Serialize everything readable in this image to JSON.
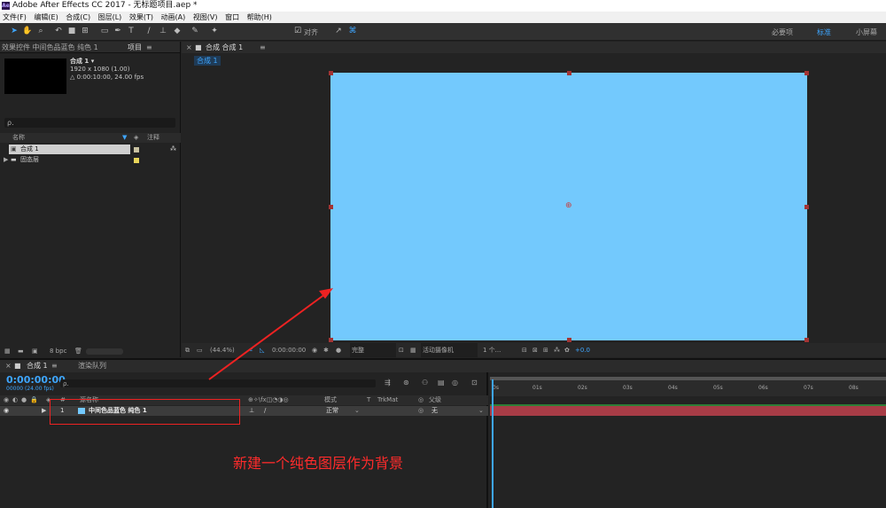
{
  "window": {
    "title": "Adobe After Effects CC 2017 - 无标题项目.aep *",
    "logo": "Ae"
  },
  "menu": [
    "文件(F)",
    "编辑(E)",
    "合成(C)",
    "图层(L)",
    "效果(T)",
    "动画(A)",
    "视图(V)",
    "窗口",
    "帮助(H)"
  ],
  "toolbar": {
    "align_label": "对齐",
    "workspaces": [
      "必要项",
      "标准",
      "小屏幕"
    ],
    "active_workspace": "标准"
  },
  "project": {
    "header": "效果控件 中间色品蓝色 纯色 1",
    "tab": "项目",
    "comp_name": "合成 1 ▾",
    "comp_size": "1920 x 1080 (1.00)",
    "comp_duration": "△ 0:00:10:00, 24.00 fps",
    "search_placeholder": "ρ.",
    "col_name": "名称",
    "col_note": "注释",
    "items": [
      {
        "name": "合成 1",
        "color": "#c9c2a2"
      },
      {
        "name": "固态层",
        "color": "#e8d55a"
      }
    ],
    "bpc": "8 bpc"
  },
  "viewer": {
    "tab": "合成 合成 1",
    "subtab": "合成 1",
    "zoom": "(44.4%)",
    "timecode": "0:00:00:00",
    "quality": "完整",
    "camera": "活动摄像机",
    "views": "1 个...",
    "exposure": "+0.0",
    "solid_color": "#73c9fd"
  },
  "timeline": {
    "tab": "合成 1",
    "render_tab": "渲染队列",
    "timecode": "0:00:00:00",
    "fps": "00000 (24.00 fps)",
    "cols": {
      "num": "#",
      "source": "源名称",
      "mode": "模式",
      "t": "T",
      "trkmat": "TrkMat",
      "parent": "父级"
    },
    "layer": {
      "num": "1",
      "name": "中间色品蓝色 纯色 1",
      "mode": "正常",
      "parent": "无"
    },
    "ruler": [
      "0s",
      "01s",
      "02s",
      "03s",
      "04s",
      "05s",
      "06s",
      "07s",
      "08s"
    ]
  },
  "annotation": "新建一个纯色图层作为背景"
}
